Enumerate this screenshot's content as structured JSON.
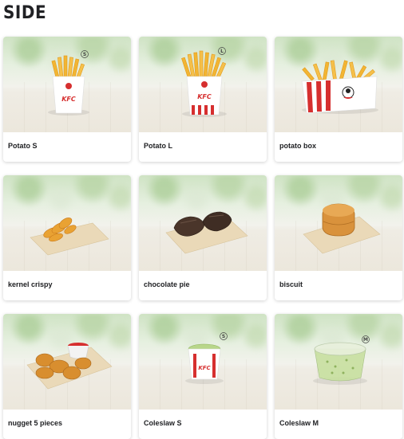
{
  "section": {
    "title": "SIDE"
  },
  "products": [
    {
      "name": "Potato S",
      "icon": "small-fries-icon",
      "size_badge": "S"
    },
    {
      "name": "Potato L",
      "icon": "large-fries-icon",
      "size_badge": "L"
    },
    {
      "name": "potato box",
      "icon": "fries-box-icon",
      "size_badge": ""
    },
    {
      "name": "kernel crispy",
      "icon": "corn-crisps-icon",
      "size_badge": ""
    },
    {
      "name": "chocolate pie",
      "icon": "chocolate-pie-icon",
      "size_badge": ""
    },
    {
      "name": "biscuit",
      "icon": "biscuit-icon",
      "size_badge": ""
    },
    {
      "name": "nugget 5 pieces",
      "icon": "nuggets-icon",
      "size_badge": ""
    },
    {
      "name": "Coleslaw S",
      "icon": "coleslaw-cup-icon",
      "size_badge": "S"
    },
    {
      "name": "Coleslaw M",
      "icon": "coleslaw-tub-icon",
      "size_badge": "M"
    }
  ],
  "colors": {
    "brand_red": "#d62f2f",
    "fries_yellow": "#f2b533",
    "card_bg": "#ffffff"
  }
}
